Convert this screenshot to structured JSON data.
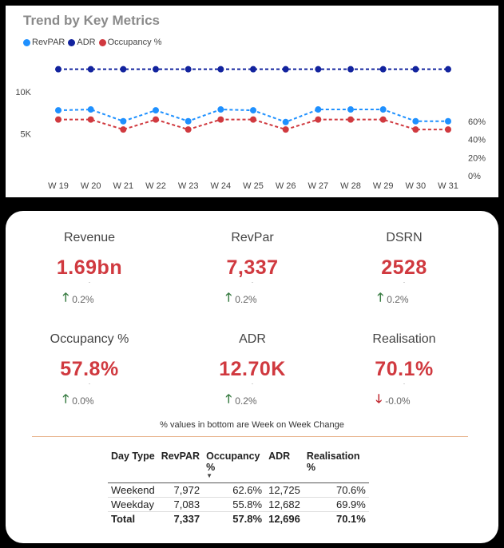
{
  "chart_data": {
    "type": "line",
    "title": "Trend by Key Metrics",
    "categories": [
      "W 19",
      "W 20",
      "W 21",
      "W 22",
      "W 23",
      "W 24",
      "W 25",
      "W 26",
      "W 27",
      "W 28",
      "W 29",
      "W 30",
      "W 31"
    ],
    "left_axis_ticks": [
      "5K",
      "10K"
    ],
    "right_axis_ticks": [
      "0%",
      "20%",
      "40%",
      "60%"
    ],
    "series": [
      {
        "name": "RevPAR",
        "axis": "left",
        "color": "#1e90ff",
        "values": [
          7800,
          7900,
          6500,
          7800,
          6500,
          7900,
          7800,
          6400,
          7900,
          7900,
          7900,
          6500,
          6500
        ]
      },
      {
        "name": "ADR",
        "axis": "left",
        "color": "#12239e",
        "values": [
          12700,
          12700,
          12700,
          12700,
          12700,
          12700,
          12700,
          12700,
          12700,
          12700,
          12700,
          12700,
          12700
        ]
      },
      {
        "name": "Occupancy %",
        "axis": "right",
        "color": "#d0393f",
        "values": [
          62,
          62,
          51,
          62,
          51,
          62,
          62,
          51,
          62,
          62,
          62,
          51,
          51
        ]
      }
    ],
    "left_ylim": [
      0,
      15500
    ],
    "right_ylim": [
      0,
      65
    ],
    "legend_position": "top-left"
  },
  "kpis": [
    {
      "label": "Revenue",
      "value": "1.69bn",
      "dot": ".",
      "direction": "up",
      "change": "0.2%"
    },
    {
      "label": "RevPar",
      "value": "7,337",
      "dot": ".",
      "direction": "up",
      "change": "0.2%"
    },
    {
      "label": "DSRN",
      "value": "2528",
      "dot": ".",
      "direction": "up",
      "change": "0.2%"
    },
    {
      "label": "Occupancy %",
      "value": "57.8%",
      "dot": ".",
      "direction": "up",
      "change": "0.0%"
    },
    {
      "label": "ADR",
      "value": "12.70K",
      "dot": ".",
      "direction": "up",
      "change": "0.2%"
    },
    {
      "label": "Realisation",
      "value": "70.1%",
      "dot": ".",
      "direction": "down",
      "change": "-0.0%"
    }
  ],
  "note": "% values in bottom are Week on Week Change",
  "table": {
    "headers": [
      "Day Type",
      "RevPAR",
      "Occupancy %",
      "ADR",
      "Realisation %"
    ],
    "rows": [
      [
        "Weekend",
        "7,972",
        "62.6%",
        "12,725",
        "70.6%"
      ],
      [
        "Weekday",
        "7,083",
        "55.8%",
        "12,682",
        "69.9%"
      ]
    ],
    "total": [
      "Total",
      "7,337",
      "57.8%",
      "12,696",
      "70.1%"
    ]
  }
}
